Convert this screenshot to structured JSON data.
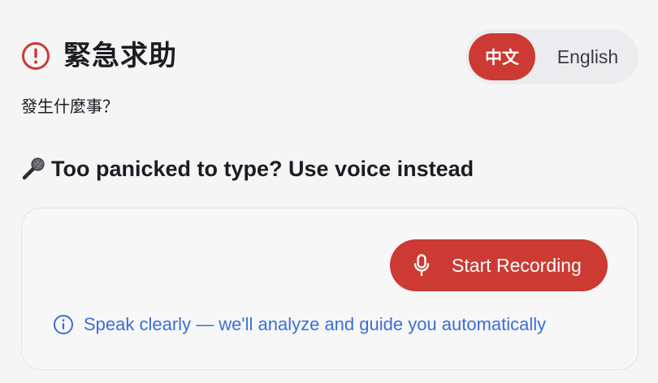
{
  "header": {
    "title": "緊急求助",
    "alert_icon": "alert-circle-icon",
    "alert_color": "#cc3a33"
  },
  "language_toggle": {
    "options": [
      "中文",
      "English"
    ],
    "selected": "中文",
    "active_color": "#cc3a33"
  },
  "subtitle": "發生什麼事？",
  "voice_section": {
    "emoji_icon": "microphone-emoji-icon",
    "heading": "Too panicked to type? Use voice instead",
    "record_button": {
      "label": "Start Recording",
      "icon": "microphone-icon",
      "color": "#cc3a33"
    },
    "hint": {
      "icon": "info-icon",
      "text": "Speak clearly — we'll analyze and guide you automatically",
      "color": "#3a6fd8"
    }
  }
}
